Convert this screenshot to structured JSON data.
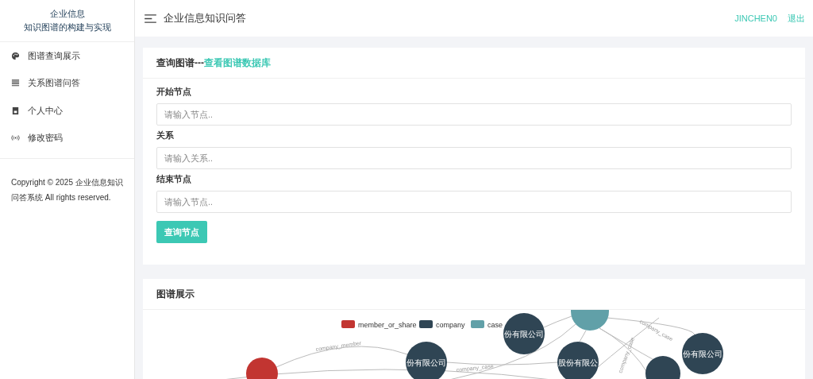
{
  "sidebar": {
    "title_lines": [
      "企业信息",
      "知识图谱的构建与实现"
    ],
    "items": [
      {
        "label": "图谱查询展示"
      },
      {
        "label": "关系图谱问答"
      },
      {
        "label": "个人中心"
      },
      {
        "label": "修改密码"
      }
    ],
    "copyright": "Copyright © 2025 企业信息知识问答系统 All rights reserved."
  },
  "topbar": {
    "title": "企业信息知识问答",
    "user": "JINCHEN0",
    "logout": "退出"
  },
  "query_card": {
    "title": "查询图谱---",
    "link": "查看图谱数据库",
    "fields": [
      {
        "label": "开始节点",
        "placeholder": "请输入节点.."
      },
      {
        "label": "关系",
        "placeholder": "请输入关系.."
      },
      {
        "label": "结束节点",
        "placeholder": "请输入节点.."
      }
    ],
    "button": "查询节点"
  },
  "graph_card": {
    "title": "图谱展示",
    "legend": [
      {
        "label": "member_or_share",
        "color": "#c23531"
      },
      {
        "label": "company",
        "color": "#2f4554"
      },
      {
        "label": "case",
        "color": "#61a0a8"
      }
    ],
    "nodes": [
      {
        "kind": "case"
      },
      {
        "kind": "company",
        "label": "份有限公司"
      },
      {
        "kind": "company",
        "label": "份有限公司"
      },
      {
        "kind": "company",
        "label": "股份有限公"
      },
      {
        "kind": "company",
        "label": "份有限公司"
      },
      {
        "kind": "company"
      },
      {
        "kind": "member_or_share"
      }
    ],
    "edge_labels": [
      "company_member",
      "company_case",
      "company_case",
      "company_case"
    ]
  }
}
